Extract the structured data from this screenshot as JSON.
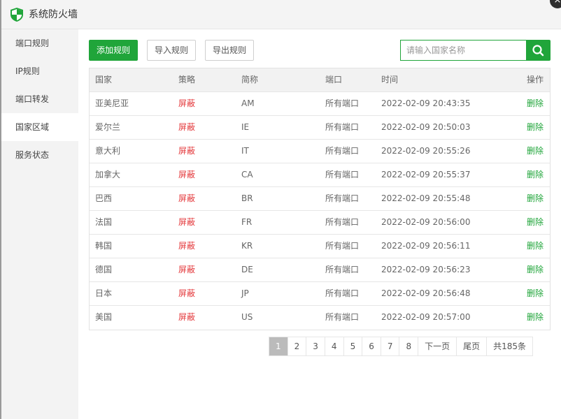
{
  "window": {
    "title": "系统防火墙",
    "close_symbol": "×"
  },
  "sidebar": {
    "items": [
      {
        "label": "端口规则"
      },
      {
        "label": "IP规则"
      },
      {
        "label": "端口转发"
      },
      {
        "label": "国家区域",
        "active": true
      },
      {
        "label": "服务状态"
      }
    ]
  },
  "toolbar": {
    "add_label": "添加规则",
    "import_label": "导入规则",
    "export_label": "导出规则",
    "search_placeholder": "请输入国家名称",
    "search_icon": "search-icon"
  },
  "table": {
    "headers": {
      "country": "国家",
      "policy": "策略",
      "code": "简称",
      "port": "端口",
      "time": "时间",
      "op": "操作"
    },
    "rows": [
      {
        "country": "亚美尼亚",
        "policy": "屏蔽",
        "code": "AM",
        "port": "所有端口",
        "time": "2022-02-09 20:43:35",
        "op": "删除"
      },
      {
        "country": "爱尔兰",
        "policy": "屏蔽",
        "code": "IE",
        "port": "所有端口",
        "time": "2022-02-09 20:50:03",
        "op": "删除"
      },
      {
        "country": "意大利",
        "policy": "屏蔽",
        "code": "IT",
        "port": "所有端口",
        "time": "2022-02-09 20:55:26",
        "op": "删除"
      },
      {
        "country": "加拿大",
        "policy": "屏蔽",
        "code": "CA",
        "port": "所有端口",
        "time": "2022-02-09 20:55:37",
        "op": "删除"
      },
      {
        "country": "巴西",
        "policy": "屏蔽",
        "code": "BR",
        "port": "所有端口",
        "time": "2022-02-09 20:55:48",
        "op": "删除"
      },
      {
        "country": "法国",
        "policy": "屏蔽",
        "code": "FR",
        "port": "所有端口",
        "time": "2022-02-09 20:56:00",
        "op": "删除"
      },
      {
        "country": "韩国",
        "policy": "屏蔽",
        "code": "KR",
        "port": "所有端口",
        "time": "2022-02-09 20:56:11",
        "op": "删除"
      },
      {
        "country": "德国",
        "policy": "屏蔽",
        "code": "DE",
        "port": "所有端口",
        "time": "2022-02-09 20:56:23",
        "op": "删除"
      },
      {
        "country": "日本",
        "policy": "屏蔽",
        "code": "JP",
        "port": "所有端口",
        "time": "2022-02-09 20:56:48",
        "op": "删除"
      },
      {
        "country": "美国",
        "policy": "屏蔽",
        "code": "US",
        "port": "所有端口",
        "time": "2022-02-09 20:57:00",
        "op": "删除"
      }
    ]
  },
  "pagination": {
    "pages": [
      "1",
      "2",
      "3",
      "4",
      "5",
      "6",
      "7",
      "8"
    ],
    "current": "1",
    "next_label": "下一页",
    "last_label": "尾页",
    "total_label": "共185条"
  },
  "colors": {
    "accent": "#20a53a",
    "danger": "#e4393c",
    "sidebar_bg": "#f3f3f3"
  }
}
